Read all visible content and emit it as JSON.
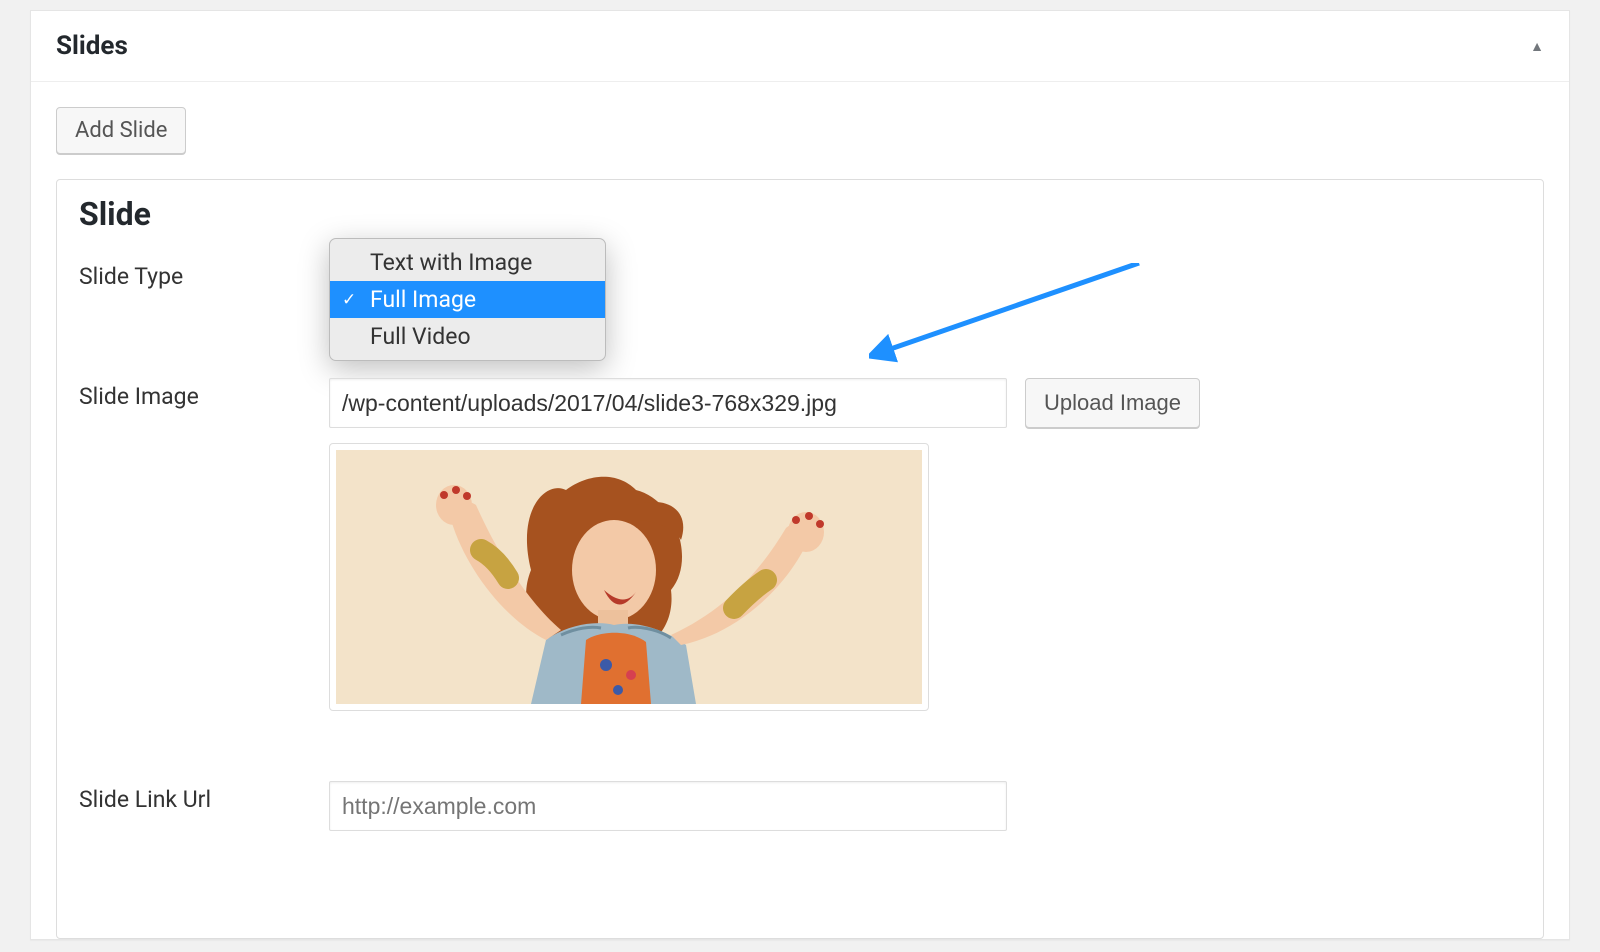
{
  "panel": {
    "title": "Slides",
    "add_button": "Add Slide"
  },
  "slide": {
    "heading": "Slide",
    "type_label": "Slide Type",
    "type_options": {
      "text_with_image": "Text with Image",
      "full_image": "Full Image",
      "full_video": "Full Video"
    },
    "type_selected": "Full Image",
    "image_label": "Slide Image",
    "image_path": "/wp-content/uploads/2017/04/slide3-768x329.jpg",
    "upload_label": "Upload Image",
    "link_label": "Slide Link Url",
    "link_placeholder": "http://example.com"
  },
  "arrow": {
    "color": "#1e90ff"
  }
}
